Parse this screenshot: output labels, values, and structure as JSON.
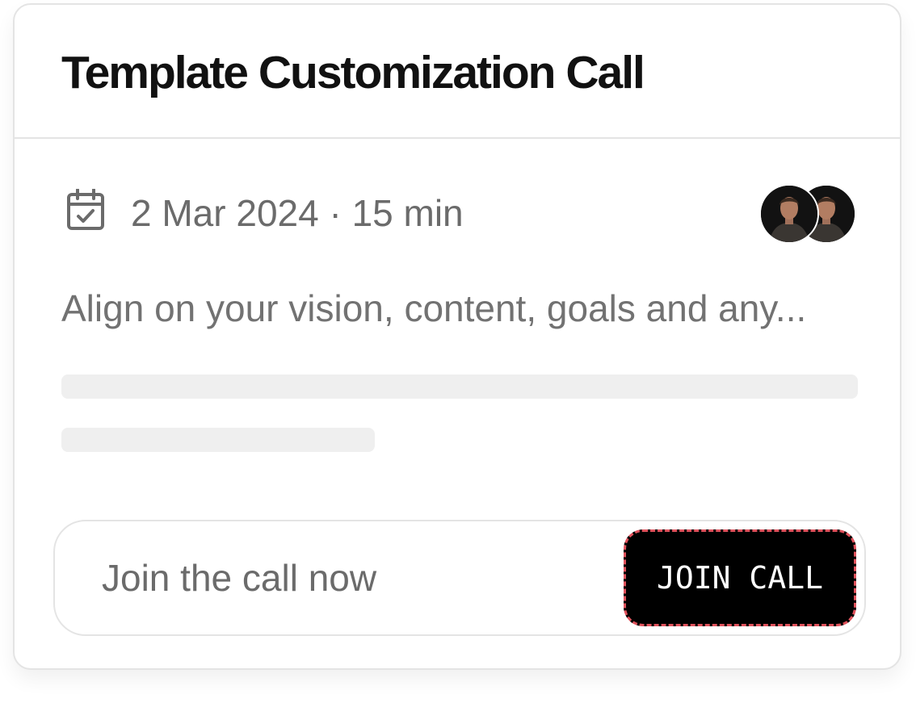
{
  "card": {
    "title": "Template Customization Call",
    "meta": {
      "icon": "calendar-check-icon",
      "date_duration": "2 Mar 2024 · 15 min"
    },
    "attendees": [
      {
        "name": "attendee-avatar"
      },
      {
        "name": "attendee-avatar"
      }
    ],
    "description": "Align on your vision, content, goals and any..."
  },
  "cta": {
    "text": "Join the call now",
    "button_label": "JOIN CALL"
  },
  "colors": {
    "title": "#111111",
    "muted_text": "#6b6b6b",
    "border": "#e4e4e4",
    "skeleton": "#efefef",
    "button_bg": "#000000",
    "button_text": "#ffffff",
    "button_focus_outline": "#e0525c"
  }
}
